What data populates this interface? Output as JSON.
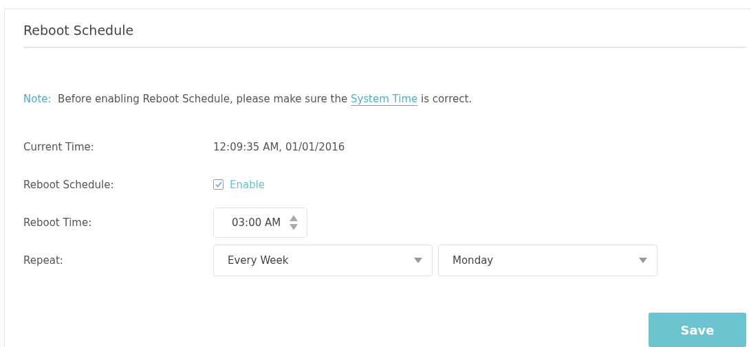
{
  "panel": {
    "title": "Reboot Schedule"
  },
  "note": {
    "label": "Note:",
    "before": "Before enabling Reboot Schedule, please make sure the",
    "link": "System Time",
    "after": "is correct."
  },
  "fields": [
    {
      "kind": "text",
      "label": "Current Time:",
      "value": "12:09:35 AM, 01/01/2016"
    },
    {
      "kind": "checkbox",
      "label": "Reboot Schedule:",
      "option": "Enable",
      "checked": true
    },
    {
      "kind": "time",
      "label": "Reboot Time:",
      "value": "03:00 AM"
    },
    {
      "kind": "selects",
      "label": "Repeat:",
      "selects": [
        "Every Week",
        "Monday"
      ]
    }
  ],
  "buttons": [
    {
      "label": "Save"
    }
  ]
}
